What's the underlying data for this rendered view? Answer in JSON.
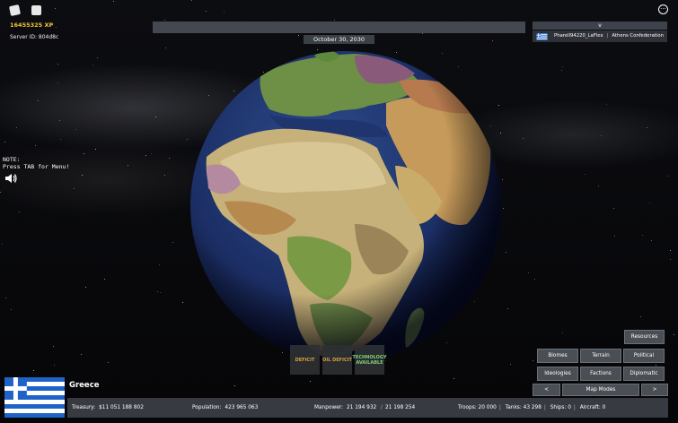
{
  "hud": {
    "xp": "16455325 XP",
    "server_id": "Server ID: 804d8c",
    "date": "October 30, 2030",
    "chevron": "v",
    "player_name": "Pharell94220_LaFlex",
    "player_faction": "Athens Confederation",
    "note_line1": "NOTE:",
    "note_line2": "Press TAB for Menu!",
    "menu_dots": "···"
  },
  "alerts": [
    {
      "label": "DEFICIT",
      "color": "#e8b040"
    },
    {
      "label": "OIL DEFICIT",
      "color": "#e8b040"
    },
    {
      "label": "TECHNOLOGY AVAILABLE",
      "color": "#8be27a"
    }
  ],
  "map_modes": {
    "resources": "Resources",
    "biomes": "Biomes",
    "terrain": "Terrain",
    "political": "Political",
    "ideologies": "Ideologies",
    "factions": "Factions",
    "diplomatic": "Diplomatic",
    "prev": "<",
    "label": "Map Modes",
    "next": ">"
  },
  "country": {
    "name": "Greece",
    "flag_colors": {
      "blue": "#1f63c8",
      "white": "#ffffff"
    }
  },
  "stats": {
    "treasury_label": "Treasury:",
    "treasury_value": "$11 051 188 802",
    "population_label": "Population:",
    "population_value": "423 965 063",
    "manpower_label": "Manpower:",
    "manpower_current": "21 194 932",
    "manpower_sep": "/",
    "manpower_max": "21 198 254",
    "troops_label": "Troops:",
    "troops_value": "20 000",
    "tanks_label": "Tanks:",
    "tanks_value": "43 298",
    "ships_label": "Ships:",
    "ships_value": "0",
    "aircraft_label": "Aircraft:",
    "aircraft_value": "0"
  }
}
